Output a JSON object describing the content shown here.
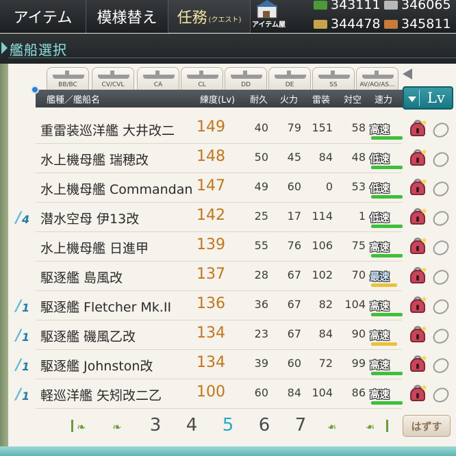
{
  "topbar": {
    "item_label": "アイテム",
    "remodel_label": "模様替え",
    "quest_label": "任務",
    "quest_ruby": "(クエスト)",
    "shop_label": "アイテム屋"
  },
  "resources": {
    "fuel": "343111",
    "ammo": "346065",
    "steel": "344478",
    "bauxite": "345811"
  },
  "title": "艦船選択",
  "type_tabs": [
    "BB/BC",
    "CV/CVL",
    "CA",
    "CL",
    "DD",
    "DE",
    "SS",
    "AV/AO/AS..."
  ],
  "header": {
    "name": "艦種／艦船名",
    "level": "練度(Lv)",
    "hp": "耐久",
    "firepower": "火力",
    "torpedo": "雷装",
    "aa": "対空",
    "speed": "速力"
  },
  "sort": {
    "label": "Lv"
  },
  "ships": [
    {
      "fleet": "",
      "name": "重雷装巡洋艦 大井改二",
      "lv": "149",
      "hp": "40",
      "fp": "79",
      "tp": "151",
      "aa": "58",
      "speed": "高速",
      "cond_color": "#3fbf3a",
      "cond": 0.92
    },
    {
      "fleet": "",
      "name": "水上機母艦 瑞穂改",
      "lv": "148",
      "hp": "50",
      "fp": "45",
      "tp": "84",
      "aa": "48",
      "speed": "低速",
      "cond_color": "#3fbf3a",
      "cond": 0.92
    },
    {
      "fleet": "",
      "name": "水上機母艦 Commandant Teste改",
      "lv": "147",
      "hp": "49",
      "fp": "60",
      "tp": "0",
      "aa": "53",
      "speed": "低速",
      "cond_color": "#3fbf3a",
      "cond": 0.92
    },
    {
      "fleet": "4",
      "name": "潜水空母 伊13改",
      "lv": "142",
      "hp": "25",
      "fp": "17",
      "tp": "114",
      "aa": "1",
      "speed": "低速",
      "cond_color": "#3fbf3a",
      "cond": 0.92
    },
    {
      "fleet": "",
      "name": "水上機母艦 日進甲",
      "lv": "139",
      "hp": "55",
      "fp": "76",
      "tp": "106",
      "aa": "75",
      "speed": "高速",
      "cond_color": "#3fbf3a",
      "cond": 0.92
    },
    {
      "fleet": "",
      "name": "駆逐艦 島風改",
      "lv": "137",
      "hp": "28",
      "fp": "67",
      "tp": "102",
      "aa": "70",
      "speed": "最速",
      "cond_color": "#e8c23a",
      "cond": 0.75
    },
    {
      "fleet": "1",
      "name": "駆逐艦 Fletcher Mk.II",
      "lv": "136",
      "hp": "36",
      "fp": "67",
      "tp": "82",
      "aa": "104",
      "speed": "高速",
      "cond_color": "#3fbf3a",
      "cond": 0.92
    },
    {
      "fleet": "1",
      "name": "駆逐艦 磯風乙改",
      "lv": "134",
      "hp": "23",
      "fp": "67",
      "tp": "84",
      "aa": "90",
      "speed": "高速",
      "cond_color": "#e8c23a",
      "cond": 0.75
    },
    {
      "fleet": "1",
      "name": "駆逐艦 Johnston改",
      "lv": "134",
      "hp": "39",
      "fp": "60",
      "tp": "72",
      "aa": "99",
      "speed": "高速",
      "cond_color": "#3fbf3a",
      "cond": 0.92
    },
    {
      "fleet": "1",
      "name": "軽巡洋艦 矢矧改二乙",
      "lv": "100",
      "hp": "60",
      "fp": "84",
      "tp": "104",
      "aa": "86",
      "speed": "高速",
      "cond_color": "#3fbf3a",
      "cond": 0.92
    }
  ],
  "pager": {
    "first_icon": "first-page-icon",
    "prev_icon": "prev-page-icon",
    "pages": [
      "3",
      "4",
      "5",
      "6",
      "7"
    ],
    "current": "5",
    "next_icon": "next-page-icon",
    "last_icon": "last-page-icon"
  },
  "remove_label": "はずす"
}
